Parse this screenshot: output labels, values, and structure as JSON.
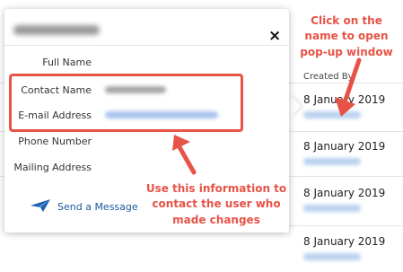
{
  "popup": {
    "close_glyph": "×",
    "fields": [
      {
        "label": "Full Name"
      },
      {
        "label": "Contact Name"
      },
      {
        "label": "E-mail Address"
      },
      {
        "label": "Phone Number"
      },
      {
        "label": "Mailing Address"
      }
    ],
    "send_message_label": "Send a Message"
  },
  "table": {
    "created_by_header": "Created By",
    "rows": [
      {
        "date": "8 January 2019"
      },
      {
        "date": "8 January 2019"
      },
      {
        "date": "8 January 2019"
      },
      {
        "date": "8 January 2019"
      }
    ]
  },
  "annotations": {
    "top_right": "Click on the name to open pop-up window",
    "bottom": "Use this information to contact the user who made changes"
  },
  "colors": {
    "annotation_red": "#e75346",
    "link_blue": "#1b5aa0",
    "send_icon_blue": "#1e5fb4"
  }
}
